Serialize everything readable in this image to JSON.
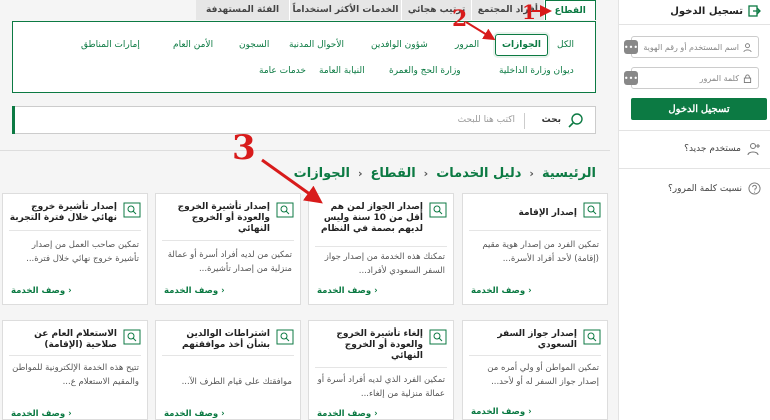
{
  "login": {
    "title": "تسجيل الدخول",
    "id_placeholder": "اسم المستخدم أو رقم الهوية",
    "pw_placeholder": "كلمة المرور",
    "button": "تسجيل الدخول",
    "new_user": "مستخدم جديد؟",
    "forgot": "نسيت كلمة المرور؟"
  },
  "tabs": [
    "القطاع",
    "أفراد المجتمع",
    "ترتيب هجائي",
    "الخدمات الأكثر استخداماً",
    "الفئة المستهدفة"
  ],
  "categories_row1": [
    "الكل",
    "الجوازات",
    "المرور",
    "شؤون الوافدين",
    "الأحوال المدنية",
    "السجون",
    "الأمن العام",
    "إمارات المناطق"
  ],
  "categories_row2": [
    "ديوان وزارة الداخلية",
    "وزارة الحج والعمرة",
    "النيابة العامة",
    "خدمات عامة"
  ],
  "search": {
    "label": "بحث",
    "placeholder": "اكتب هنا للبحث"
  },
  "breadcrumb": [
    "الرئيسية",
    "دليل الخدمات",
    "القطاع",
    "الجوازات"
  ],
  "more_label": "وصف الخدمة",
  "cards_row1": [
    {
      "title": "إصدار الإقامة",
      "desc": "تمكين الفرد من إصدار هوية مقيم (إقامة) لأحد أفراد الأسرة..."
    },
    {
      "title": "إصدار الجواز لمن هم أقل من 10 سنة وليس لديهم بصمة في النظام",
      "desc": "تمكنك هذه الخدمة من إصدار جواز السفر السعودي لأفراد..."
    },
    {
      "title": "إصدار تأشيرة الخروج والعودة أو الخروج النهائي",
      "desc": "تمكين من لديه أفراد أسرة أو عمالة منزلية من إصدار تأشيرة..."
    },
    {
      "title": "إصدار تأشيرة خروج نهائي خلال فترة التجربة",
      "desc": "تمكين صاحب العمل من إصدار تأشيرة خروج نهائي خلال فترة..."
    }
  ],
  "cards_row2": [
    {
      "title": "إصدار جواز السفر السعودي",
      "desc": "تمكين المواطن أو ولي أمره من إصدار جواز السفر له أو لأحد..."
    },
    {
      "title": "إلغاء تأشيرة الخروج والعودة أو الخروج النهائي",
      "desc": "تمكين الفرد الذي لديه أفراد أسرة أو عمالة منزلية من إلغاء..."
    },
    {
      "title": "اشتراطات الوالدين بشأن أخذ موافقتهم",
      "desc": "موافقتك على قيام الطرف الآ..."
    },
    {
      "title": "الاستعلام العام عن صلاحية (الإقامة)",
      "desc": "تتيح هذه الخدمة الإلكترونية للمواطن والمقيم الاستعلام ع..."
    }
  ],
  "annotations": [
    "1",
    "2",
    "3"
  ],
  "colors": {
    "accent": "#0c7a43",
    "annotation": "#d81b1b"
  }
}
